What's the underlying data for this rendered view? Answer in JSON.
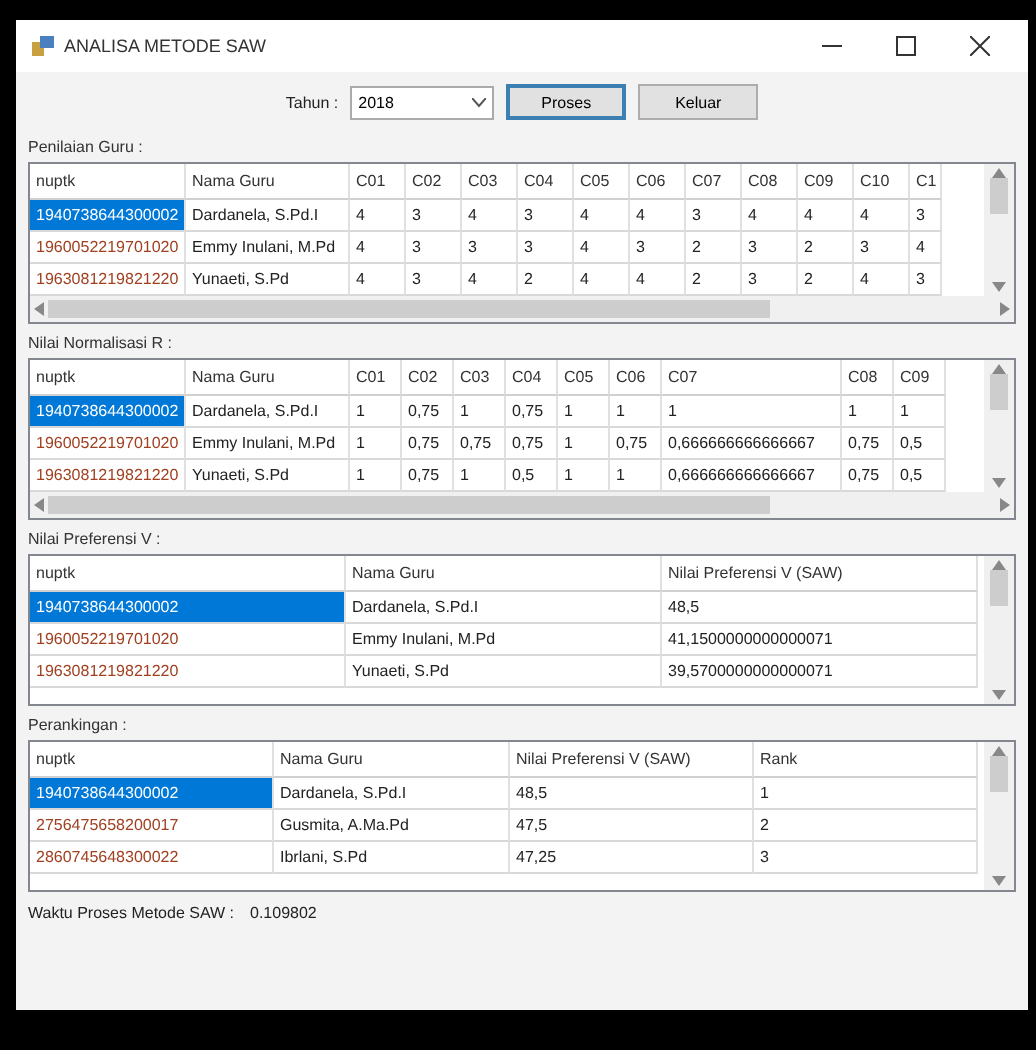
{
  "window": {
    "title": "ANALISA METODE SAW"
  },
  "toolbar": {
    "year_label": "Tahun :",
    "year": "2018",
    "buttons": [
      {
        "label": "Proses",
        "selected": true
      },
      {
        "label": "Keluar",
        "selected": false
      }
    ]
  },
  "grids": [
    {
      "title": "Penilaian Guru :",
      "h_scroll": true,
      "columns": [
        "nuptk",
        "Nama Guru",
        "C01",
        "C02",
        "C03",
        "C04",
        "C05",
        "C06",
        "C07",
        "C08",
        "C09",
        "C10",
        "C1"
      ],
      "rows": [
        {
          "selected": true,
          "cells": [
            "1940738644300002",
            "Dardanela, S.Pd.I",
            "4",
            "3",
            "4",
            "3",
            "4",
            "4",
            "3",
            "4",
            "4",
            "4",
            "3"
          ]
        },
        {
          "selected": false,
          "cells": [
            "1960052219701020",
            "Emmy Inulani, M.Pd",
            "4",
            "3",
            "3",
            "3",
            "4",
            "3",
            "2",
            "3",
            "2",
            "3",
            "4"
          ]
        },
        {
          "selected": false,
          "cells": [
            "1963081219821220",
            "Yunaeti, S.Pd",
            "4",
            "3",
            "4",
            "2",
            "4",
            "4",
            "2",
            "3",
            "2",
            "4",
            "3"
          ]
        }
      ]
    },
    {
      "title": "Nilai Normalisasi R :",
      "h_scroll": true,
      "columns": [
        "nuptk",
        "Nama Guru",
        "C01",
        "C02",
        "C03",
        "C04",
        "C05",
        "C06",
        "C07",
        "C08",
        "C09"
      ],
      "rows": [
        {
          "selected": true,
          "cells": [
            "1940738644300002",
            "Dardanela, S.Pd.I",
            "1",
            "0,75",
            "1",
            "0,75",
            "1",
            "1",
            "1",
            "1",
            "1"
          ]
        },
        {
          "selected": false,
          "cells": [
            "1960052219701020",
            "Emmy Inulani, M.Pd",
            "1",
            "0,75",
            "0,75",
            "0,75",
            "1",
            "0,75",
            "0,666666666666667",
            "0,75",
            "0,5"
          ]
        },
        {
          "selected": false,
          "cells": [
            "1963081219821220",
            "Yunaeti, S.Pd",
            "1",
            "0,75",
            "1",
            "0,5",
            "1",
            "1",
            "0,666666666666667",
            "0,75",
            "0,5"
          ]
        }
      ]
    },
    {
      "title": "Nilai Preferensi V :",
      "columns": [
        "nuptk",
        "Nama Guru",
        "Nilai Preferensi V (SAW)"
      ],
      "rows": [
        {
          "selected": true,
          "cells": [
            "1940738644300002",
            "Dardanela, S.Pd.I",
            "48,5"
          ]
        },
        {
          "selected": false,
          "cells": [
            "1960052219701020",
            "Emmy Inulani, M.Pd",
            "41,1500000000000071"
          ]
        },
        {
          "selected": false,
          "cells": [
            "1963081219821220",
            "Yunaeti, S.Pd",
            "39,5700000000000071"
          ]
        }
      ]
    },
    {
      "title": "Perankingan :",
      "columns": [
        "nuptk",
        "Nama Guru",
        "Nilai Preferensi V (SAW)",
        "Rank"
      ],
      "rows": [
        {
          "selected": true,
          "cells": [
            "1940738644300002",
            "Dardanela, S.Pd.I",
            "48,5",
            "1"
          ]
        },
        {
          "selected": false,
          "cells": [
            "2756475658200017",
            "Gusmita, A.Ma.Pd",
            "47,5",
            "2"
          ]
        },
        {
          "selected": false,
          "cells": [
            "2860745648300022",
            "Ibrlani, S.Pd",
            "47,25",
            "3"
          ]
        }
      ]
    }
  ],
  "status": {
    "label": "Waktu Proses Metode SAW :",
    "value": "0.109802"
  }
}
